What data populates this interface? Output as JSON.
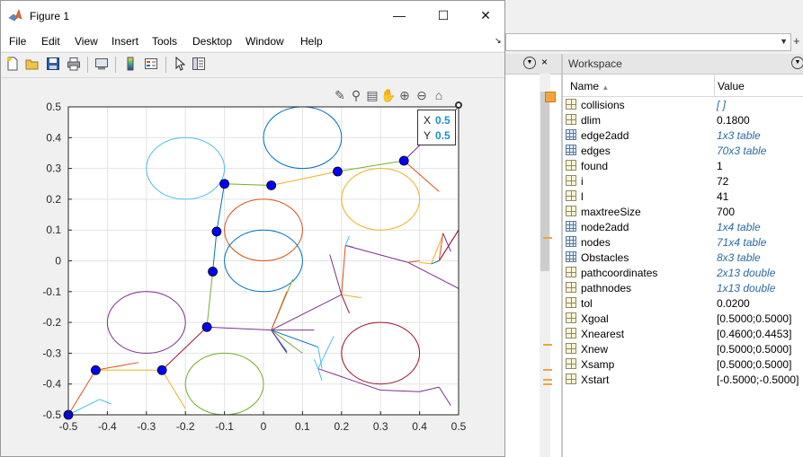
{
  "desktop": {
    "workspace": {
      "title": "Workspace",
      "col_name": "Name",
      "col_value": "Value",
      "variables": [
        {
          "name": "collisions",
          "value": "[ ]",
          "icon": "matrix-icon",
          "italic": true
        },
        {
          "name": "dlim",
          "value": "0.1800",
          "icon": "matrix-icon",
          "italic": false
        },
        {
          "name": "edge2add",
          "value": "1x3 table",
          "icon": "table-icon",
          "italic": true
        },
        {
          "name": "edges",
          "value": "70x3 table",
          "icon": "table-icon",
          "italic": true
        },
        {
          "name": "found",
          "value": "1",
          "icon": "matrix-icon",
          "italic": false
        },
        {
          "name": "i",
          "value": "72",
          "icon": "matrix-icon",
          "italic": false
        },
        {
          "name": "l",
          "value": "41",
          "icon": "matrix-icon",
          "italic": false
        },
        {
          "name": "maxtreeSize",
          "value": "700",
          "icon": "matrix-icon",
          "italic": false
        },
        {
          "name": "node2add",
          "value": "1x4 table",
          "icon": "table-icon",
          "italic": true
        },
        {
          "name": "nodes",
          "value": "71x4 table",
          "icon": "table-icon",
          "italic": true
        },
        {
          "name": "Obstacles",
          "value": "8x3 table",
          "icon": "table-icon",
          "italic": true
        },
        {
          "name": "pathcoordinates",
          "value": "2x13 double",
          "icon": "matrix-icon",
          "italic": true
        },
        {
          "name": "pathnodes",
          "value": "1x13 double",
          "icon": "matrix-icon",
          "italic": true
        },
        {
          "name": "tol",
          "value": "0.0200",
          "icon": "matrix-icon",
          "italic": false
        },
        {
          "name": "Xgoal",
          "value": "[0.5000;0.5000]",
          "icon": "matrix-icon",
          "italic": false
        },
        {
          "name": "Xnearest",
          "value": "[0.4600;0.4453]",
          "icon": "matrix-icon",
          "italic": false
        },
        {
          "name": "Xnew",
          "value": "[0.5000;0.5000]",
          "icon": "matrix-icon",
          "italic": false
        },
        {
          "name": "Xsamp",
          "value": "[0.5000;0.5000]",
          "icon": "matrix-icon",
          "italic": false
        },
        {
          "name": "Xstart",
          "value": "[-0.5000;-0.5000]",
          "icon": "matrix-icon",
          "italic": false
        }
      ]
    }
  },
  "figure": {
    "title": "Figure 1",
    "menu": [
      "File",
      "Edit",
      "View",
      "Insert",
      "Tools",
      "Desktop",
      "Window",
      "Help"
    ],
    "toolbar_icons": [
      "new-figure-icon",
      "open-icon",
      "save-icon",
      "print-icon",
      "link-icon",
      "colorbar-icon",
      "legend-icon",
      "pointer-icon",
      "property-inspector-icon"
    ],
    "axes_toolbar_icons": [
      "brush-icon",
      "data-tips-icon",
      "rotate-icon",
      "pan-icon",
      "zoom-in-icon",
      "zoom-out-icon",
      "home-icon"
    ],
    "datatip": {
      "x_label": "X",
      "x_value": "0.5",
      "y_label": "Y",
      "y_value": "0.5"
    }
  },
  "chart_data": {
    "type": "scatter",
    "title": "",
    "xlabel": "",
    "ylabel": "",
    "xlim": [
      -0.5,
      0.5
    ],
    "ylim": [
      -0.5,
      0.5
    ],
    "xticks": [
      "-0.5",
      "-0.4",
      "-0.3",
      "-0.2",
      "-0.1",
      "0",
      "0.1",
      "0.2",
      "0.3",
      "0.4",
      "0.5"
    ],
    "yticks": [
      "-0.5",
      "-0.4",
      "-0.3",
      "-0.2",
      "-0.1",
      "0",
      "0.1",
      "0.2",
      "0.3",
      "0.4",
      "0.5"
    ],
    "grid": true,
    "obstacles": [
      {
        "cx": 0.1,
        "cy": 0.4,
        "r": 0.1,
        "color": "#0072bd"
      },
      {
        "cx": -0.2,
        "cy": 0.3,
        "r": 0.1,
        "color": "#4dbeee"
      },
      {
        "cx": 0.3,
        "cy": 0.2,
        "r": 0.1,
        "color": "#edb120"
      },
      {
        "cx": 0.0,
        "cy": 0.1,
        "r": 0.1,
        "color": "#d95319"
      },
      {
        "cx": 0.0,
        "cy": 0.0,
        "r": 0.1,
        "color": "#0072bd"
      },
      {
        "cx": -0.3,
        "cy": -0.2,
        "r": 0.1,
        "color": "#7e2f8e"
      },
      {
        "cx": 0.3,
        "cy": -0.3,
        "r": 0.1,
        "color": "#a2142f"
      },
      {
        "cx": -0.1,
        "cy": -0.4,
        "r": 0.1,
        "color": "#77ac30"
      }
    ],
    "tree_edges": [
      {
        "from": [
          -0.5,
          -0.5
        ],
        "to": [
          -0.43,
          -0.355
        ],
        "color": "#d95319"
      },
      {
        "from": [
          -0.43,
          -0.355
        ],
        "to": [
          -0.26,
          -0.355
        ],
        "color": "#edb120"
      },
      {
        "from": [
          -0.43,
          -0.355
        ],
        "to": [
          -0.44,
          -0.35
        ],
        "color": "#edb120"
      },
      {
        "from": [
          -0.43,
          -0.355
        ],
        "to": [
          -0.32,
          -0.33
        ],
        "color": "#d95319"
      },
      {
        "from": [
          -0.5,
          -0.5
        ],
        "to": [
          -0.42,
          -0.45
        ],
        "color": "#4dbeee"
      },
      {
        "from": [
          -0.42,
          -0.45
        ],
        "to": [
          -0.39,
          -0.465
        ],
        "color": "#4dbeee"
      },
      {
        "from": [
          -0.26,
          -0.355
        ],
        "to": [
          -0.2,
          -0.48
        ],
        "color": "#edb120"
      },
      {
        "from": [
          -0.26,
          -0.355
        ],
        "to": [
          -0.145,
          -0.215
        ],
        "color": "#a2142f"
      },
      {
        "from": [
          -0.145,
          -0.215
        ],
        "to": [
          -0.13,
          -0.035
        ],
        "color": "#77ac30"
      },
      {
        "from": [
          -0.13,
          -0.035
        ],
        "to": [
          -0.12,
          0.095
        ],
        "color": "#0072bd"
      },
      {
        "from": [
          -0.12,
          0.095
        ],
        "to": [
          -0.1,
          0.25
        ],
        "color": "#0072bd"
      },
      {
        "from": [
          -0.1,
          0.25
        ],
        "to": [
          0.02,
          0.245
        ],
        "color": "#77ac30"
      },
      {
        "from": [
          0.02,
          0.245
        ],
        "to": [
          0.19,
          0.29
        ],
        "color": "#edb120"
      },
      {
        "from": [
          0.19,
          0.29
        ],
        "to": [
          0.36,
          0.325
        ],
        "color": "#77ac30"
      },
      {
        "from": [
          0.36,
          0.325
        ],
        "to": [
          0.5,
          0.5
        ],
        "color": "#7e2f8e"
      },
      {
        "from": [
          0.36,
          0.325
        ],
        "to": [
          0.45,
          0.225
        ],
        "color": "#d95319"
      },
      {
        "from": [
          -0.145,
          -0.215
        ],
        "to": [
          0.02,
          -0.225
        ],
        "color": "#7e2f8e"
      },
      {
        "from": [
          0.02,
          -0.225
        ],
        "to": [
          0.075,
          -0.06
        ],
        "color": "#77ac30"
      },
      {
        "from": [
          0.02,
          -0.225
        ],
        "to": [
          0.06,
          -0.295
        ],
        "color": "#0072bd"
      },
      {
        "from": [
          0.02,
          -0.225
        ],
        "to": [
          0.06,
          -0.3
        ],
        "color": "#7e2f8e"
      },
      {
        "from": [
          0.02,
          -0.225
        ],
        "to": [
          0.1,
          -0.3
        ],
        "color": "#77ac30"
      },
      {
        "from": [
          0.02,
          -0.225
        ],
        "to": [
          0.13,
          -0.225
        ],
        "color": "#7e2f8e"
      },
      {
        "from": [
          0.02,
          -0.225
        ],
        "to": [
          0.2,
          -0.11
        ],
        "color": "#7e2f8e"
      },
      {
        "from": [
          0.02,
          -0.225
        ],
        "to": [
          0.06,
          -0.1
        ],
        "color": "#d95319"
      },
      {
        "from": [
          0.2,
          -0.11
        ],
        "to": [
          0.22,
          -0.17
        ],
        "color": "#a2142f"
      },
      {
        "from": [
          0.2,
          -0.11
        ],
        "to": [
          0.25,
          -0.12
        ],
        "color": "#edb120"
      },
      {
        "from": [
          0.2,
          -0.11
        ],
        "to": [
          0.21,
          0.05
        ],
        "color": "#d95319"
      },
      {
        "from": [
          0.21,
          0.05
        ],
        "to": [
          0.23,
          0.045
        ],
        "color": "#4dbeee"
      },
      {
        "from": [
          0.21,
          0.05
        ],
        "to": [
          0.37,
          -0.005
        ],
        "color": "#7e2f8e"
      },
      {
        "from": [
          0.37,
          -0.005
        ],
        "to": [
          0.5,
          -0.09
        ],
        "color": "#7e2f8e"
      },
      {
        "from": [
          0.37,
          -0.005
        ],
        "to": [
          0.4,
          0.0
        ],
        "color": "#d95319"
      },
      {
        "from": [
          0.4,
          -0.005
        ],
        "to": [
          0.43,
          -0.01
        ],
        "color": "#edb120"
      },
      {
        "from": [
          0.43,
          -0.01
        ],
        "to": [
          0.46,
          0.085
        ],
        "color": "#edb120"
      },
      {
        "from": [
          0.43,
          -0.01
        ],
        "to": [
          0.45,
          0.0
        ],
        "color": "#0072bd"
      },
      {
        "from": [
          0.45,
          0.0
        ],
        "to": [
          0.5,
          0.1
        ],
        "color": "#a2142f"
      },
      {
        "from": [
          0.45,
          0.0
        ],
        "to": [
          0.5,
          0.1
        ],
        "color": "#a2142f"
      },
      {
        "from": [
          0.45,
          0.0
        ],
        "to": [
          0.46,
          0.09
        ],
        "color": "#d95319"
      },
      {
        "from": [
          0.46,
          0.09
        ],
        "to": [
          0.48,
          0.03
        ],
        "color": "#7e2f8e"
      },
      {
        "from": [
          0.02,
          -0.225
        ],
        "to": [
          0.14,
          -0.28
        ],
        "color": "#0072bd"
      },
      {
        "from": [
          0.14,
          -0.28
        ],
        "to": [
          0.15,
          -0.35
        ],
        "color": "#4dbeee"
      },
      {
        "from": [
          0.14,
          -0.35
        ],
        "to": [
          0.18,
          -0.245
        ],
        "color": "#4dbeee"
      },
      {
        "from": [
          0.14,
          -0.35
        ],
        "to": [
          0.13,
          -0.32
        ],
        "color": "#4dbeee"
      },
      {
        "from": [
          0.14,
          -0.35
        ],
        "to": [
          0.3,
          -0.42
        ],
        "color": "#7e2f8e"
      },
      {
        "from": [
          0.3,
          -0.42
        ],
        "to": [
          0.4,
          -0.425
        ],
        "color": "#7e2f8e"
      },
      {
        "from": [
          0.4,
          -0.425
        ],
        "to": [
          0.45,
          -0.41
        ],
        "color": "#7e2f8e"
      },
      {
        "from": [
          0.45,
          -0.41
        ],
        "to": [
          0.48,
          -0.47
        ],
        "color": "#7e2f8e"
      },
      {
        "from": [
          0.14,
          -0.35
        ],
        "to": [
          0.15,
          -0.39
        ],
        "color": "#4dbeee"
      },
      {
        "from": [
          0.2,
          -0.11
        ],
        "to": [
          0.17,
          0.02
        ],
        "color": "#7e2f8e"
      },
      {
        "from": [
          0.21,
          0.05
        ],
        "to": [
          0.22,
          0.08
        ],
        "color": "#4dbeee"
      }
    ],
    "path_nodes": [
      [
        -0.5,
        -0.5
      ],
      [
        -0.43,
        -0.355
      ],
      [
        -0.26,
        -0.355
      ],
      [
        -0.145,
        -0.215
      ],
      [
        -0.13,
        -0.035
      ],
      [
        -0.12,
        0.095
      ],
      [
        -0.1,
        0.25
      ],
      [
        0.02,
        0.245
      ],
      [
        0.19,
        0.29
      ],
      [
        0.36,
        0.325
      ]
    ]
  }
}
